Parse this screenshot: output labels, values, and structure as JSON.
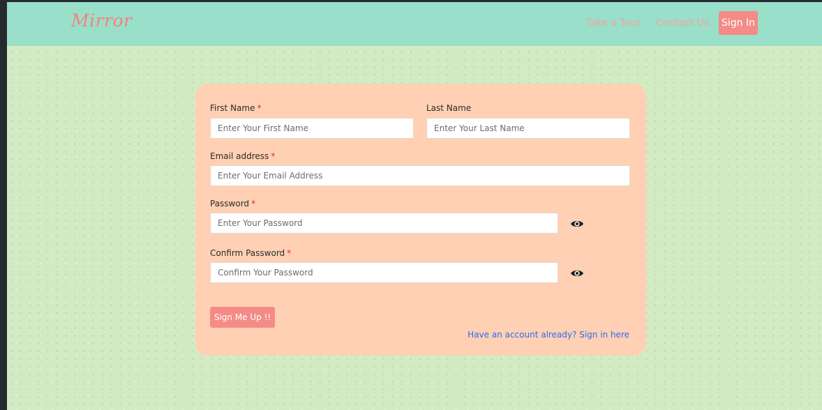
{
  "navbar": {
    "brand": "Mirror",
    "links": [
      "Take a Tour",
      "Contact Us"
    ],
    "signin_label": "Sign In",
    "background_color": "#99dfca",
    "accent_color": "#f58b86"
  },
  "form": {
    "first_name": {
      "label": "First Name",
      "required_mark": "*",
      "placeholder": "Enter Your First Name",
      "value": ""
    },
    "last_name": {
      "label": "Last Name",
      "placeholder": "Enter Your Last Name",
      "value": ""
    },
    "email": {
      "label": "Email address",
      "required_mark": "*",
      "placeholder": "Enter Your Email Address",
      "value": ""
    },
    "password": {
      "label": "Password",
      "required_mark": "*",
      "placeholder": "Enter Your Password",
      "value": "",
      "toggle_icon": "eye-icon"
    },
    "confirm_password": {
      "label": "Confirm Password",
      "required_mark": "*",
      "placeholder": "Confirm Your Password",
      "value": "",
      "toggle_icon": "eye-icon"
    },
    "submit_label": "Sign Me Up !!",
    "signin_link": "Have an account already? Sign in here",
    "card_color": "#ffd0b3",
    "page_background": "#d3ebc3"
  }
}
